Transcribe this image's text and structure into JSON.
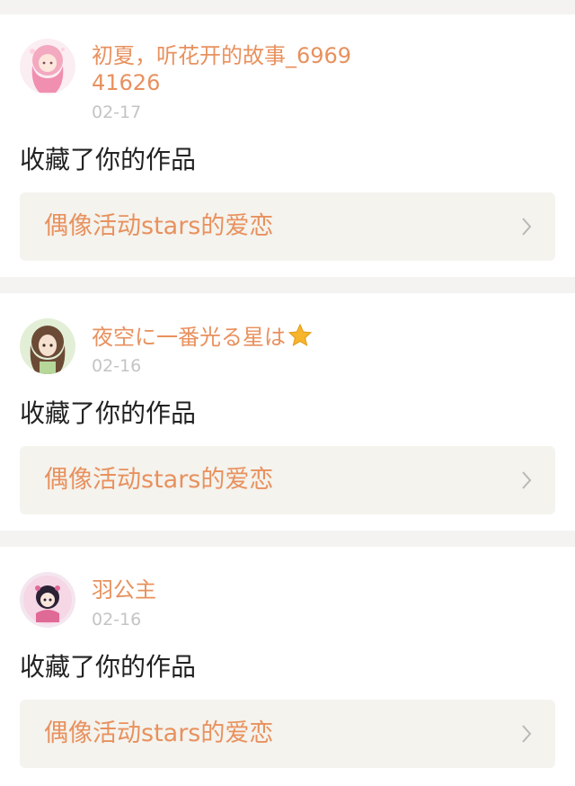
{
  "notifications": [
    {
      "username": "初夏，听花开的故事_696941626",
      "date": "02-17",
      "action": "收藏了你的作品",
      "work_title": "偶像活动stars的爱恋",
      "avatar_icon": "pink-haired-girl-avatar"
    },
    {
      "username": "夜空に一番光る星は",
      "username_emoji": "star-emoji",
      "date": "02-16",
      "action": "收藏了你的作品",
      "work_title": "偶像活动stars的爱恋",
      "avatar_icon": "brown-haired-girl-avatar"
    },
    {
      "username": "羽公主",
      "date": "02-16",
      "action": "收藏了你的作品",
      "work_title": "偶像活动stars的爱恋",
      "avatar_icon": "chibi-character-avatar"
    }
  ],
  "colors": {
    "accent": "#e8915e",
    "date_gray": "#c4c4c4",
    "text_dark": "#222222",
    "link_bg": "#f4f3ee",
    "page_bg": "#f4f3f1",
    "star": "#f7b52c"
  },
  "chevron_icon": "chevron-right-icon"
}
